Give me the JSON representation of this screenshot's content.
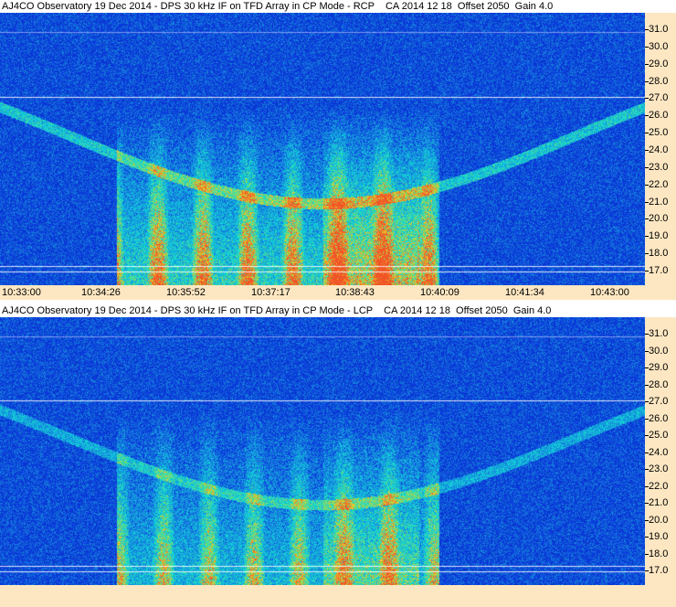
{
  "panels": [
    {
      "title": "AJ4CO Observatory 19 Dec 2014 - DPS 30 kHz IF on TFD Array in CP Mode - RCP    CA 2014 12 18  Offset 2050  Gain 4.0",
      "time_labels": [
        "10:33:00",
        "10:34:26",
        "10:35:52",
        "10:37:17",
        "10:38:43",
        "10:40:09",
        "10:41:34",
        "10:43:00"
      ]
    },
    {
      "title": "AJ4CO Observatory 19 Dec 2014 - DPS 30 kHz IF on TFD Array in CP Mode - LCP    CA 2014 12 18  Offset 2050  Gain 4.0",
      "time_labels": []
    }
  ],
  "freq_labels": [
    "31.0",
    "30.0",
    "29.0",
    "28.0",
    "27.0",
    "26.0",
    "25.0",
    "24.0",
    "23.0",
    "22.0",
    "21.0",
    "20.0",
    "19.0",
    "18.0",
    "17.0"
  ],
  "colors": {
    "spectrogram_base": "#1437c8",
    "axis_background": "#fde7c2"
  }
}
